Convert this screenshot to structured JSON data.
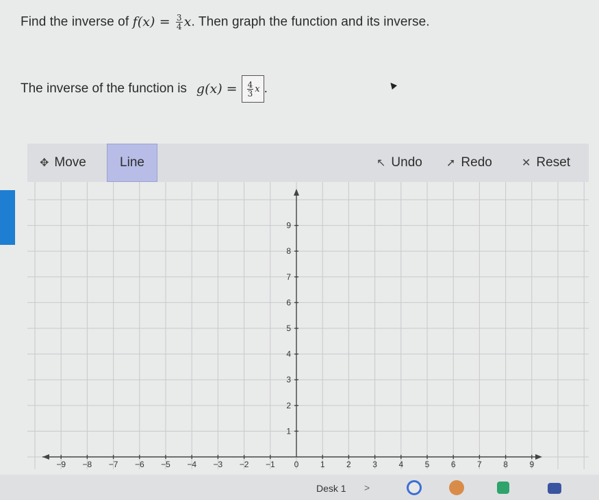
{
  "question": {
    "prefix": "Find the inverse of ",
    "func_name": "f(x) = ",
    "frac_num": "3",
    "frac_den": "4",
    "var": "x",
    "suffix": ". Then graph the function and its inverse."
  },
  "answer": {
    "label": "The inverse of the function is ",
    "func_name": "g(x) = ",
    "frac_num": "4",
    "frac_den": "3",
    "var": "x",
    "suffix": "."
  },
  "toolbar": {
    "move_label": "Move",
    "line_label": "Line",
    "undo_label": "Undo",
    "redo_label": "Redo",
    "reset_label": "Reset"
  },
  "graph": {
    "x_ticks": [
      "−9",
      "−8",
      "−7",
      "−6",
      "−5",
      "−4",
      "−3",
      "−2",
      "−1",
      "0",
      "1",
      "2",
      "3",
      "4",
      "5",
      "6",
      "7",
      "8",
      "9"
    ],
    "y_ticks": [
      "1",
      "2",
      "3",
      "4",
      "5",
      "6",
      "7",
      "8",
      "9"
    ]
  },
  "taskbar": {
    "desk_label": "Desk 1",
    "desk_arrow": ">"
  },
  "colors": {
    "line_tool_active": "#b7bde6",
    "side_tab": "#1e7ed1"
  }
}
